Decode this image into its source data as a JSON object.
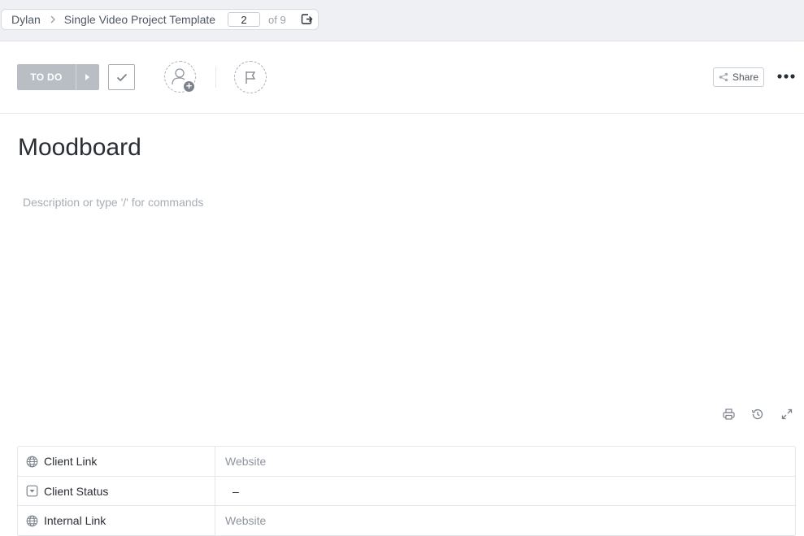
{
  "breadcrumb": {
    "space": "Dylan",
    "list": "Single Video Project Template",
    "page_current": "2",
    "page_total": "of 9"
  },
  "toolbar": {
    "status_label": "TO DO",
    "share_label": "Share"
  },
  "task": {
    "title": "Moodboard",
    "description_placeholder": "Description or type '/' for commands"
  },
  "custom_fields": [
    {
      "name": "Client Link",
      "icon": "globe-icon",
      "value": "Website"
    },
    {
      "name": "Client Status",
      "icon": "dropdown-field-icon",
      "value": "–"
    },
    {
      "name": "Internal Link",
      "icon": "globe-icon",
      "value": "Website"
    }
  ],
  "colors": {
    "status_todo": "#b9bec5",
    "topbar_bg": "#eff0f3"
  }
}
